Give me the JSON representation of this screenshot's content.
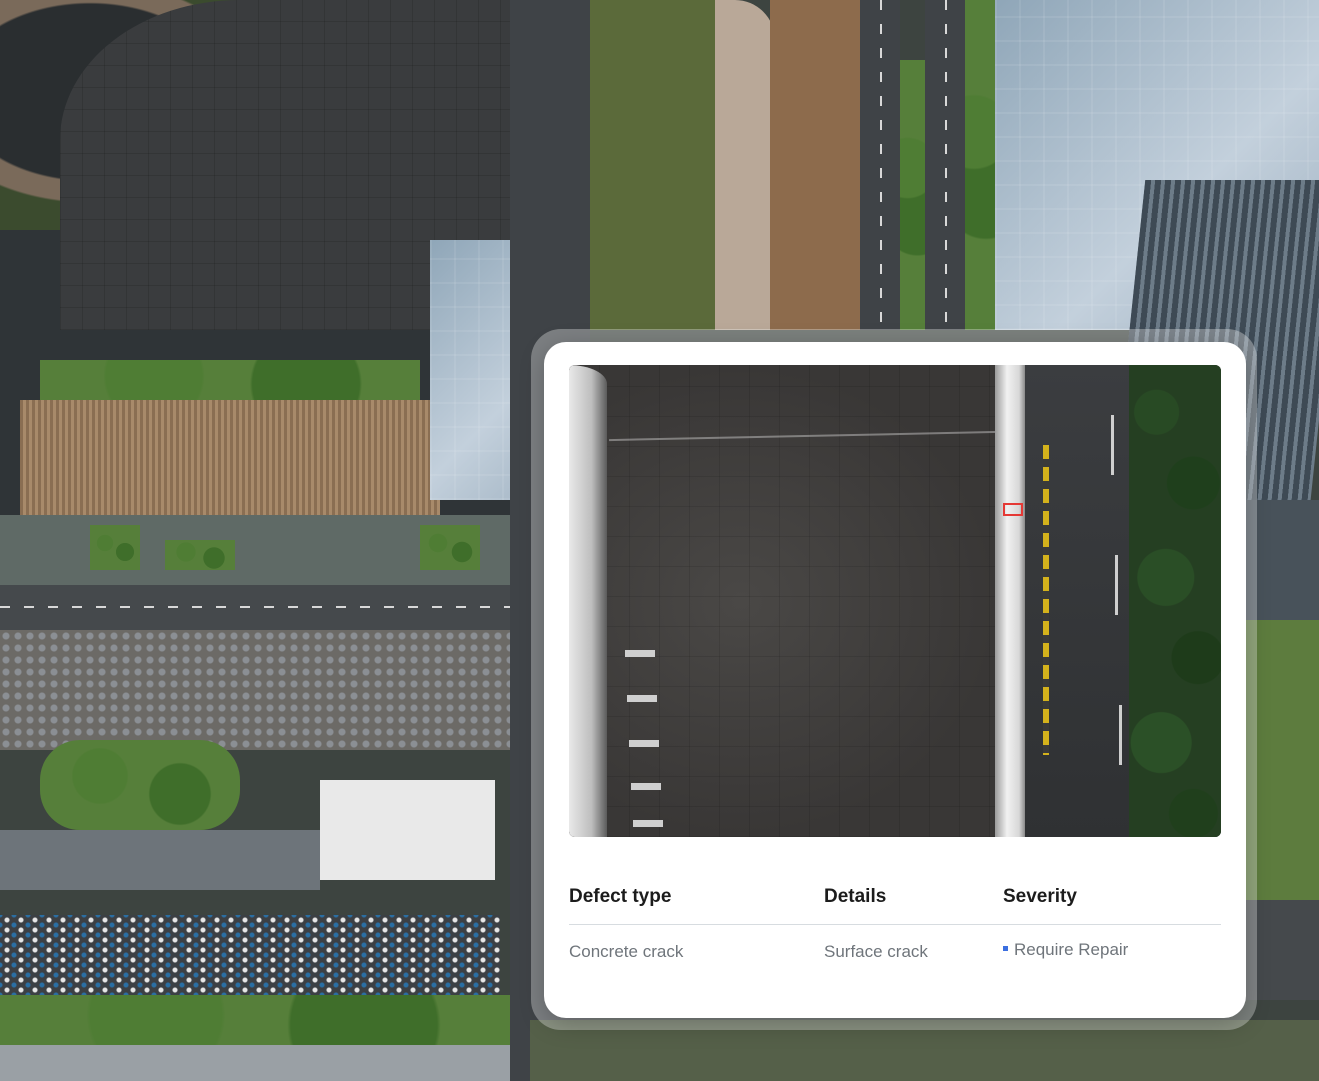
{
  "background": {
    "icon": "aerial-city-view"
  },
  "inspection": {
    "image_icon": "roof-inspection-photo",
    "marker_color": "#e53935",
    "columns": {
      "defect_type": "Defect type",
      "details": "Details",
      "severity": "Severity"
    },
    "row": {
      "defect_type": "Concrete crack",
      "details": "Surface crack",
      "severity": "Require Repair",
      "severity_color": "#3b6fe0"
    }
  }
}
